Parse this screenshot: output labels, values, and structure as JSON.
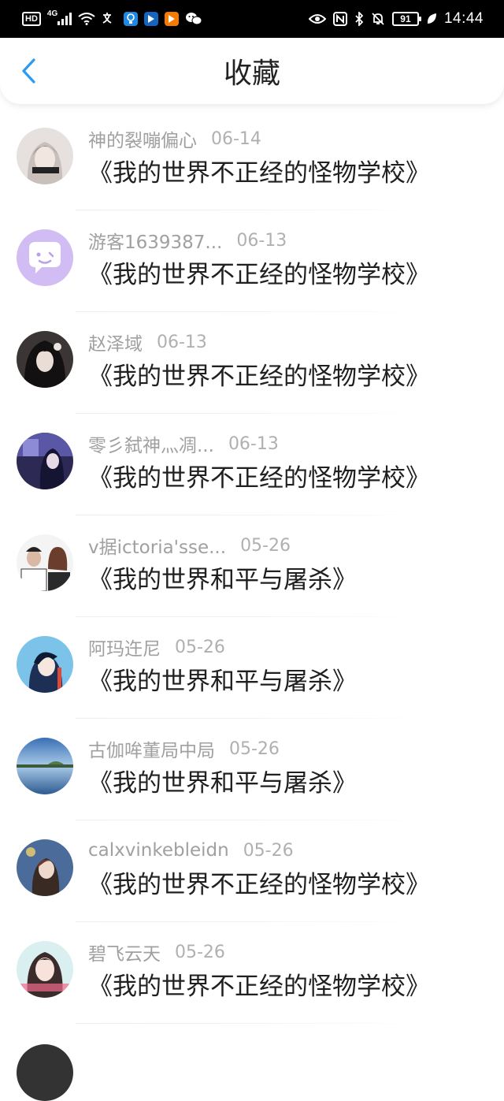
{
  "statusbar": {
    "left_label": "HD",
    "network": "4G",
    "battery": "91",
    "time": "14:44"
  },
  "header": {
    "title": "收藏"
  },
  "favorites": [
    {
      "username": "神的裂嘣偏心",
      "date": "06-14",
      "book": "《我的世界不正经的怪物学校》"
    },
    {
      "username": "游客1639387...",
      "date": "06-13",
      "book": "《我的世界不正经的怪物学校》"
    },
    {
      "username": "赵泽域",
      "date": "06-13",
      "book": "《我的世界不正经的怪物学校》"
    },
    {
      "username": "零彡弑神灬凋...",
      "date": "06-13",
      "book": "《我的世界不正经的怪物学校》"
    },
    {
      "username": "v据ictoria'sse...",
      "date": "05-26",
      "book": "《我的世界和平与屠杀》"
    },
    {
      "username": "阿玛迕尼",
      "date": "05-26",
      "book": "《我的世界和平与屠杀》"
    },
    {
      "username": "古伽哞董局中局",
      "date": "05-26",
      "book": "《我的世界和平与屠杀》"
    },
    {
      "username": "calxvinkebleidn",
      "date": "05-26",
      "book": "《我的世界不正经的怪物学校》"
    },
    {
      "username": "碧飞云天",
      "date": "05-26",
      "book": "《我的世界不正经的怪物学校》"
    }
  ],
  "colors": {
    "accent": "#2b9af3",
    "username": "#a0a0a0",
    "date": "#b0b0b0",
    "title": "#222222"
  }
}
